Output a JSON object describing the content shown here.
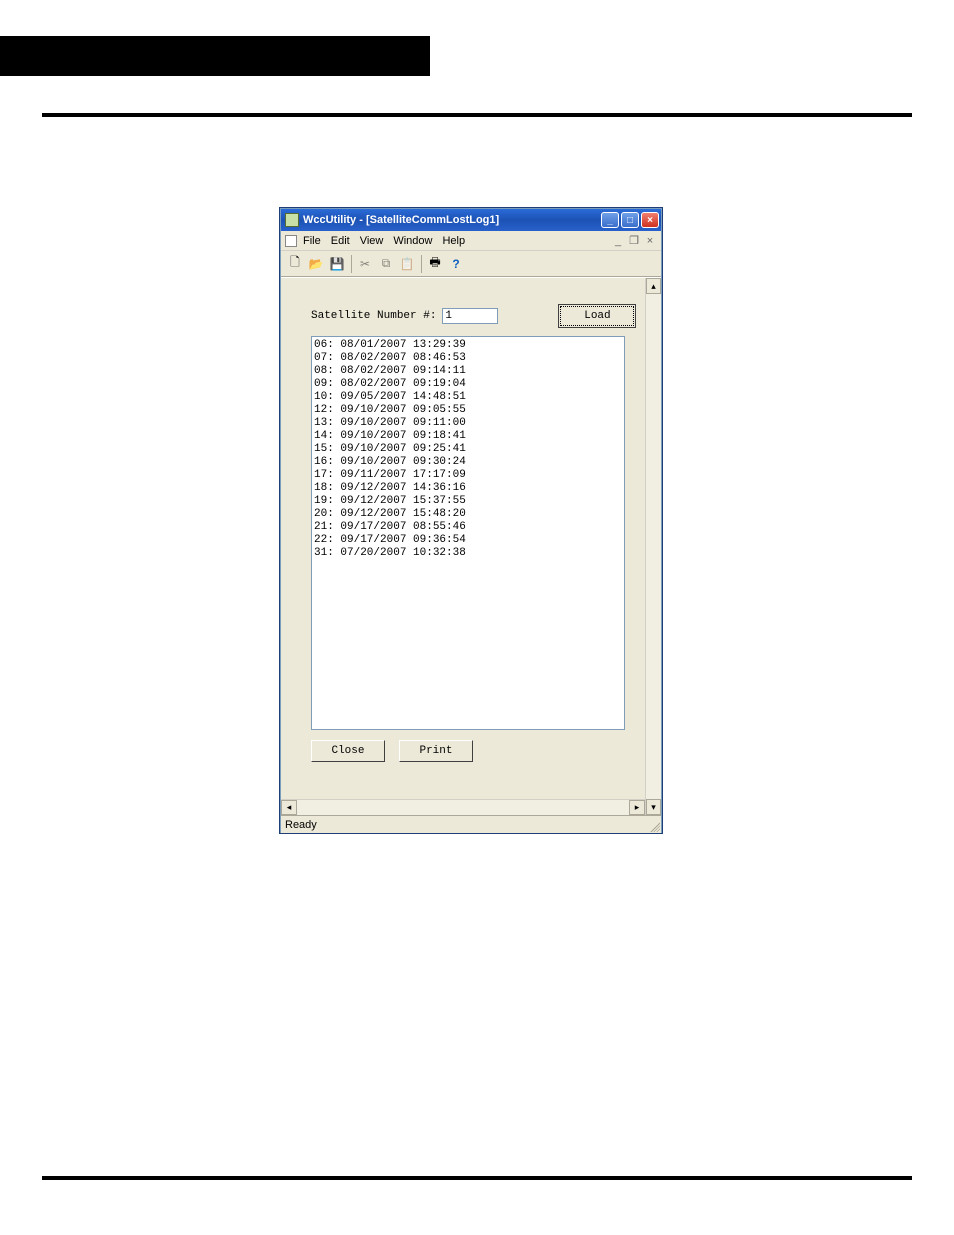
{
  "window": {
    "title": "WccUtility - [SatelliteCommLostLog1]"
  },
  "menus": {
    "file": "File",
    "edit": "Edit",
    "view": "View",
    "window": "Window",
    "help": "Help"
  },
  "toolbar": {
    "new": "new",
    "open": "open",
    "save": "save",
    "cut": "cut",
    "copy": "copy",
    "paste": "paste",
    "print": "print",
    "help": "help"
  },
  "form": {
    "satellite_label": "Satellite Number #:",
    "satellite_value": "1",
    "load_label": "Load",
    "close_label": "Close",
    "print_label": "Print"
  },
  "log_entries": [
    "06: 08/01/2007 13:29:39",
    "07: 08/02/2007 08:46:53",
    "08: 08/02/2007 09:14:11",
    "09: 08/02/2007 09:19:04",
    "10: 09/05/2007 14:48:51",
    "12: 09/10/2007 09:05:55",
    "13: 09/10/2007 09:11:00",
    "14: 09/10/2007 09:18:41",
    "15: 09/10/2007 09:25:41",
    "16: 09/10/2007 09:30:24",
    "17: 09/11/2007 17:17:09",
    "18: 09/12/2007 14:36:16",
    "19: 09/12/2007 15:37:55",
    "20: 09/12/2007 15:48:20",
    "21: 09/17/2007 08:55:46",
    "22: 09/17/2007 09:36:54",
    "31: 07/20/2007 10:32:38"
  ],
  "statusbar": {
    "text": "Ready"
  }
}
